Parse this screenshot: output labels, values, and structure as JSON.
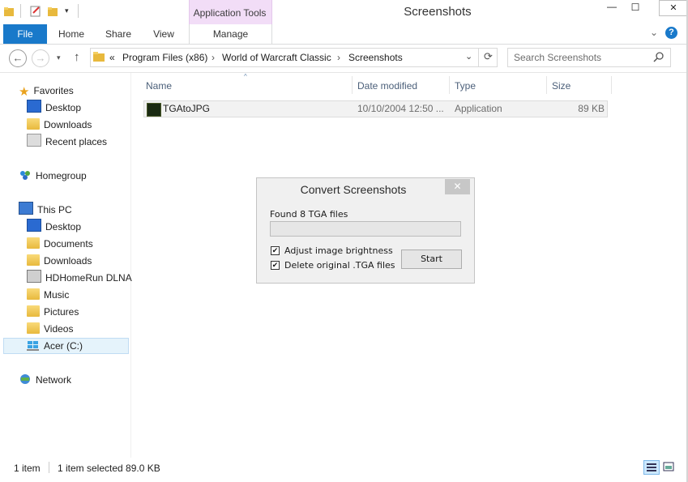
{
  "window": {
    "title": "Screenshots",
    "context_tab": "Application Tools",
    "controls": {
      "minimize": "—",
      "maximize": "☐",
      "close": "✕"
    }
  },
  "ribbon": {
    "tabs": [
      "File",
      "Home",
      "Share",
      "View",
      "Manage"
    ],
    "accent": "#1979ca"
  },
  "address": {
    "overflow": "«",
    "crumbs": [
      "Program Files (x86)",
      "World of Warcraft Classic",
      "Screenshots"
    ],
    "separator": "›",
    "search_placeholder": "Search Screenshots"
  },
  "nav": {
    "favorites": {
      "label": "Favorites",
      "items": [
        "Desktop",
        "Downloads",
        "Recent places"
      ]
    },
    "homegroup": "Homegroup",
    "this_pc": {
      "label": "This PC",
      "items": [
        "Desktop",
        "Documents",
        "Downloads",
        "HDHomeRun DLNA",
        "Music",
        "Pictures",
        "Videos",
        "Acer (C:)"
      ]
    },
    "network": "Network"
  },
  "columns": [
    "Name",
    "Date modified",
    "Type",
    "Size"
  ],
  "files": [
    {
      "name": "TGAtoJPG",
      "date": "10/10/2004 12:50 ...",
      "type": "Application",
      "size": "89 KB"
    }
  ],
  "dialog": {
    "title": "Convert Screenshots",
    "close": "✕",
    "status": "Found 8 TGA files",
    "progress": 0,
    "options": [
      {
        "label": "Adjust image brightness",
        "checked": true,
        "mark": "✔"
      },
      {
        "label": "Delete original .TGA files",
        "checked": true,
        "mark": "✔"
      }
    ],
    "button": "Start"
  },
  "statusbar": {
    "count": "1 item",
    "selected": "1 item selected  89.0 KB"
  }
}
